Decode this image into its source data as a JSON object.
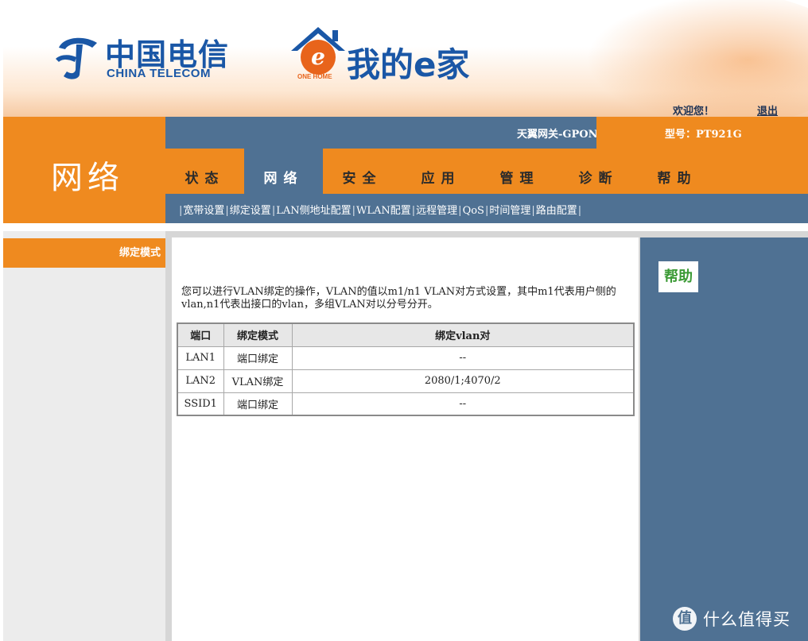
{
  "header": {
    "brand_chinese": "中国电信",
    "brand_english": "CHINA TELECOM",
    "sub_brand_one_home": "ONE HOME",
    "sub_brand_title": "我的e家",
    "welcome_text": "欢迎您！",
    "logout_label": "退出"
  },
  "info_bar": {
    "gateway_name": "天翼网关-GPON",
    "model_label": "型号：PT921G"
  },
  "section_title": "网络",
  "main_nav": [
    {
      "label": "状态",
      "active": false
    },
    {
      "label": "网络",
      "active": true
    },
    {
      "label": "安全",
      "active": false
    },
    {
      "label": "应用",
      "active": false
    },
    {
      "label": "管理",
      "active": false
    },
    {
      "label": "诊断",
      "active": false
    },
    {
      "label": "帮助",
      "active": false
    }
  ],
  "sub_nav": [
    "宽带设置",
    "绑定设置",
    "LAN侧地址配置",
    "WLAN配置",
    "远程管理",
    "QoS",
    "时间管理",
    "路由配置"
  ],
  "sidebar": {
    "active_item": "绑定模式"
  },
  "main": {
    "description": "您可以进行VLAN绑定的操作，VLAN的值以m1/n1 VLAN对方式设置，其中m1代表用户侧的vlan,n1代表出接口的vlan，多组VLAN对以分号分开。",
    "table": {
      "headers": [
        "端口",
        "绑定模式",
        "绑定vlan对"
      ],
      "rows": [
        [
          "LAN1",
          "端口绑定",
          "--"
        ],
        [
          "LAN2",
          "VLAN绑定",
          "2080/1;4070/2"
        ],
        [
          "SSID1",
          "端口绑定",
          "--"
        ]
      ]
    }
  },
  "right_panel": {
    "help_label": "帮助"
  },
  "watermark": {
    "icon_glyph": "值",
    "text": "什么值得买"
  },
  "colors": {
    "orange": "#ef8a1f",
    "steel_blue": "#4f7193",
    "telecom_blue": "#1a57a6",
    "help_green": "#3b9a35"
  }
}
